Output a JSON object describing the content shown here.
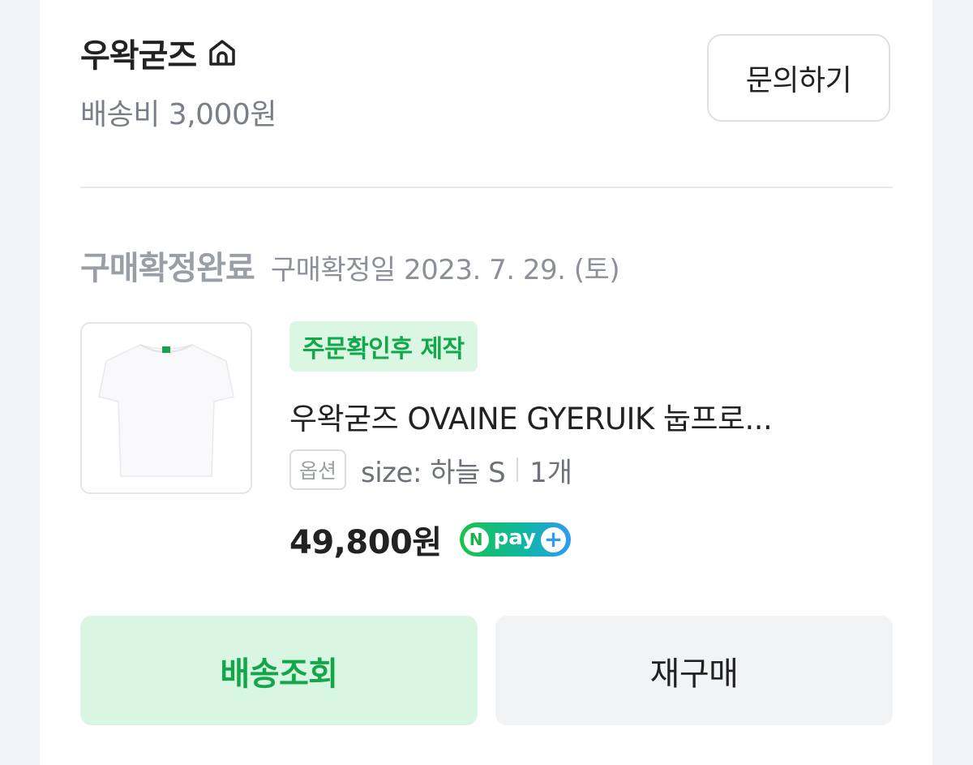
{
  "shop": {
    "name": "우왁굳즈",
    "icon": "home-icon",
    "shipping_fee": "배송비 3,000원",
    "inquiry_label": "문의하기"
  },
  "order": {
    "status": "구매확정완료",
    "confirm_date": "구매확정일 2023. 7. 29. (토)"
  },
  "item": {
    "badge": "주문확인후 제작",
    "name": "우왁굳즈 OVAINE GYERUIK 눕프로...",
    "option_tag": "옵션",
    "option_value": "size: 하늘 S",
    "quantity": "1개",
    "price": "49,800원",
    "pay_badge": {
      "n": "N",
      "text": "pay",
      "plus": "+"
    }
  },
  "actions": {
    "track_label": "배송조회",
    "rebuy_label": "재구매"
  },
  "colors": {
    "accent_green": "#13a64a",
    "badge_bg": "#dbf6e3",
    "track_bg": "#d9f6e2",
    "rebuy_bg": "#f1f3f5"
  }
}
